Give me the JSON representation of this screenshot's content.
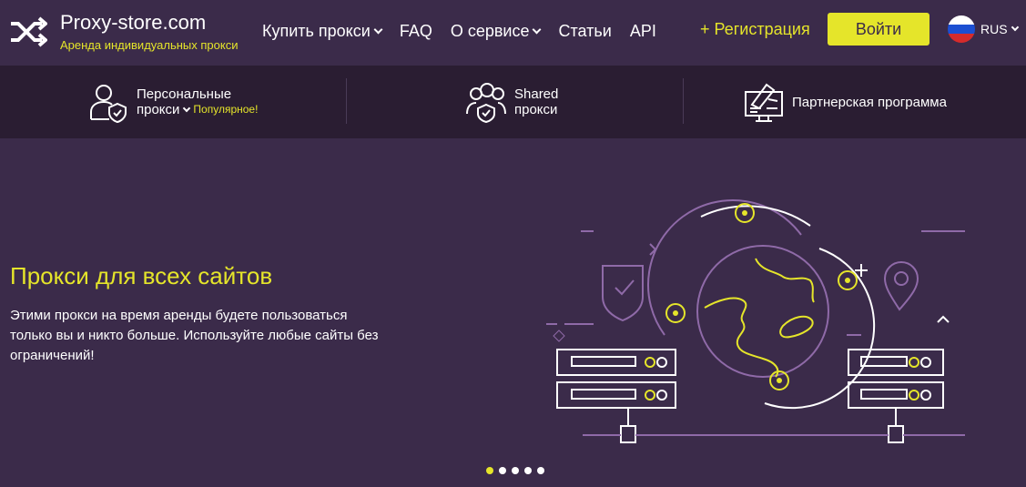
{
  "header": {
    "logo_title": "Proxy-store.com",
    "logo_subtitle": "Аренда индивидуальных прокси",
    "nav": [
      {
        "label": "Купить прокси",
        "dropdown": true
      },
      {
        "label": "FAQ",
        "dropdown": false
      },
      {
        "label": "О сервисе",
        "dropdown": true
      },
      {
        "label": "Статьи",
        "dropdown": false
      },
      {
        "label": "API",
        "dropdown": false
      }
    ],
    "register_label": "+ Регистрация",
    "login_label": "Войти",
    "language": "RUS"
  },
  "subnav": {
    "items": [
      {
        "line1": "Персональные",
        "line2": "прокси",
        "badge": "Популярное!",
        "icon": "personal-user-shield-icon"
      },
      {
        "line1": "Shared",
        "line2": "прокси",
        "icon": "shared-users-shield-icon"
      },
      {
        "line1": "Партнерская программа",
        "icon": "partner-monitor-icon"
      }
    ]
  },
  "hero": {
    "title": "Прокси для всех сайтов",
    "description": "Этими прокси на время аренды будете пользоваться только вы и никто больше. Используйте любые сайты без ограничений!",
    "illustration_icon": "globe-servers-illustration",
    "slides_total": 5,
    "active_slide": 1
  },
  "colors": {
    "background": "#3b2b4a",
    "subnav_background": "#2a1d32",
    "accent": "#e5e52a",
    "illustration_line": "#8f6aa8"
  }
}
